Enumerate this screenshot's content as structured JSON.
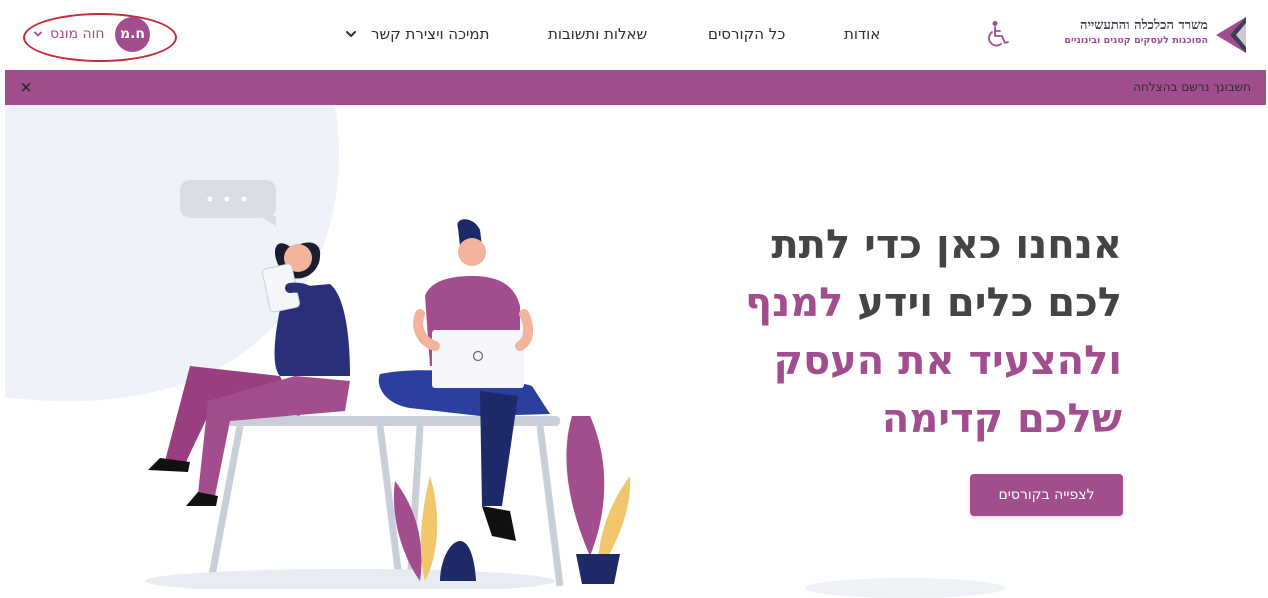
{
  "header": {
    "logo": {
      "title": "משרד הכלכלה והתעשייה",
      "subtitle": "הסוכנות לעסקים קטנים ובינוניים"
    },
    "nav": {
      "about": "אודות",
      "courses": "כל הקורסים",
      "faq": "שאלות ותשובות",
      "support": "תמיכה ויצירת קשר"
    },
    "user": {
      "initials": "ח.מ",
      "name": "חוה מונס"
    }
  },
  "notice": {
    "text": "חשבונך נרשם בהצלחה",
    "close_label": "×"
  },
  "hero": {
    "line1": "אנחנו כאן כדי לתת",
    "line2_dark": "לכם כלים וידע",
    "line2_accent": "למנף",
    "line3": "ולהצעיד את העסק",
    "line4": "שלכם קדימה",
    "cta_label": "לצפייה בקורסים"
  },
  "colors": {
    "accent": "#a24e8e",
    "headline_dark": "#444446",
    "highlight_oval": "#c4283b"
  },
  "icons": [
    "logo-mark-icon",
    "accessibility-icon",
    "chevron-down-icon",
    "close-icon"
  ]
}
